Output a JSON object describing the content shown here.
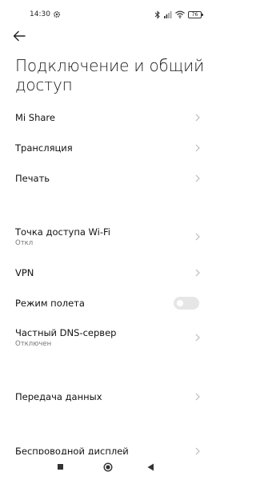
{
  "status_bar": {
    "time": "14:30",
    "icons": [
      "gear-icon",
      "bluetooth-icon",
      "signal-icon",
      "wifi-icon"
    ],
    "battery_level": "76"
  },
  "header": {
    "back_icon": "arrow-left-icon",
    "title": "Подключение и общий доступ"
  },
  "items": [
    {
      "label": "Mi Share",
      "control": "chevron"
    },
    {
      "label": "Трансляция",
      "control": "chevron"
    },
    {
      "label": "Печать",
      "control": "chevron"
    },
    {
      "label": "Точка доступа Wi-Fi",
      "subtitle": "Откл",
      "control": "chevron"
    },
    {
      "label": "VPN",
      "control": "chevron"
    },
    {
      "label": "Режим полета",
      "control": "toggle",
      "toggle_on": false
    },
    {
      "label": "Частный DNS-сервер",
      "subtitle": "Отключен",
      "control": "chevron"
    },
    {
      "label": "Передача данных",
      "control": "chevron"
    },
    {
      "label": "Беспроводной дисплей",
      "control": "chevron"
    }
  ],
  "nav_bar": {
    "icons": [
      "recents-square-icon",
      "home-circle-icon",
      "back-triangle-icon"
    ]
  },
  "colors": {
    "background": "#ffffff",
    "text_primary": "#111111",
    "text_secondary": "#777777",
    "chevron": "#bbbbbb",
    "toggle_off": "#e6e6e6"
  }
}
